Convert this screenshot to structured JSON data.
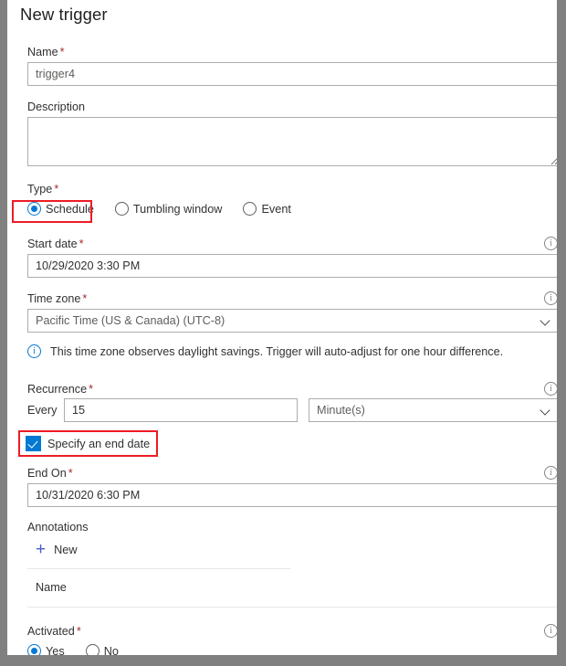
{
  "panel": {
    "title": "New trigger"
  },
  "fields": {
    "name": {
      "label": "Name",
      "required": "*",
      "value": "trigger4"
    },
    "description": {
      "label": "Description",
      "value": ""
    },
    "type": {
      "label": "Type",
      "required": "*",
      "options": [
        {
          "label": "Schedule",
          "selected": true,
          "highlighted": true
        },
        {
          "label": "Tumbling window",
          "selected": false,
          "highlighted": false
        },
        {
          "label": "Event",
          "selected": false,
          "highlighted": false
        }
      ]
    },
    "start_date": {
      "label": "Start date",
      "required": "*",
      "value": "10/29/2020 3:30 PM",
      "info_icon": "info-icon"
    },
    "time_zone": {
      "label": "Time zone",
      "required": "*",
      "value": "Pacific Time (US & Canada) (UTC-8)",
      "info_icon": "info-icon",
      "chevron": "chevron-down-icon"
    },
    "time_zone_note": {
      "icon": "info-icon",
      "text": "This time zone observes daylight savings. Trigger will auto-adjust for one hour difference."
    },
    "recurrence": {
      "label": "Recurrence",
      "required": "*",
      "every_label": "Every",
      "interval_value": "15",
      "unit_value": "Minute(s)",
      "info_icon": "info-icon",
      "chevron": "chevron-down-icon"
    },
    "specify_end_date": {
      "label": "Specify an end date",
      "checked": true,
      "highlighted": true
    },
    "end_on": {
      "label": "End On",
      "required": "*",
      "value": "10/31/2020 6:30 PM",
      "info_icon": "info-icon"
    },
    "annotations": {
      "label": "Annotations",
      "new_label": "New",
      "new_icon": "plus-icon",
      "column_header": "Name"
    },
    "activated": {
      "label": "Activated",
      "required": "*",
      "info_icon": "info-icon",
      "options": [
        {
          "label": "Yes",
          "selected": true
        },
        {
          "label": "No",
          "selected": false
        }
      ]
    }
  },
  "colors": {
    "accent": "#0078d4",
    "required_asterisk": "#a4262c",
    "highlight": "#ed1c24",
    "frame": "#808080",
    "text": "#323130"
  }
}
